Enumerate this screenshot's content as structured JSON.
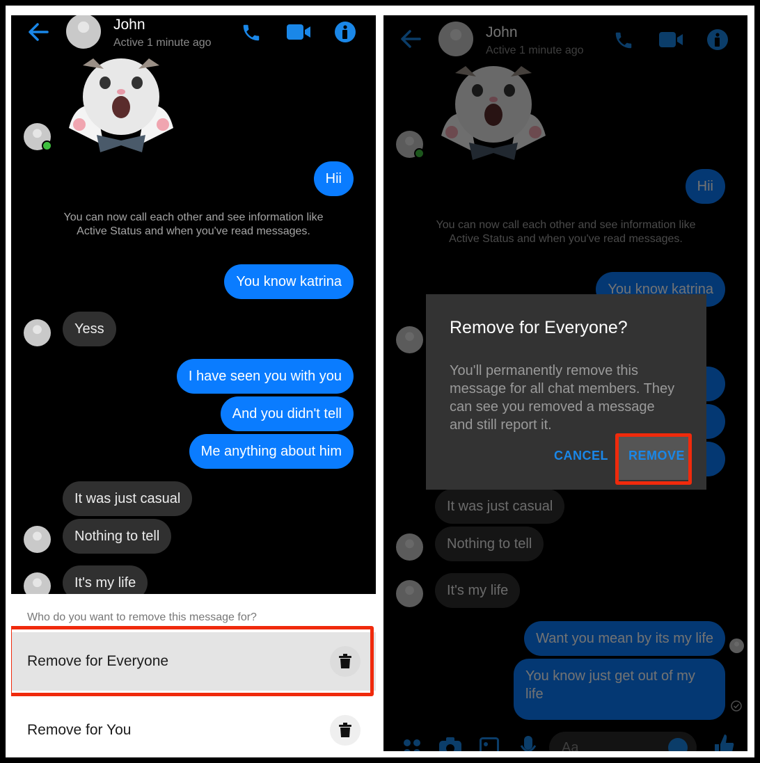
{
  "left_screen": {
    "header": {
      "contact_name": "John",
      "status": "Active 1 minute ago",
      "icons": [
        "back-arrow-icon",
        "phone-icon",
        "video-camera-icon",
        "info-icon"
      ]
    },
    "sticker": "cat-with-bowtie-sticker",
    "messages": [
      {
        "side": "out",
        "text": "Hii"
      },
      {
        "side": "system",
        "text": "You can now call each other and see information like Active Status and when you've read messages."
      },
      {
        "side": "out",
        "text": "You know katrina"
      },
      {
        "side": "in",
        "text": "Yess"
      },
      {
        "side": "out",
        "text": "I have seen you with you"
      },
      {
        "side": "out",
        "text": "And you didn't tell"
      },
      {
        "side": "out",
        "text": "Me anything about him"
      },
      {
        "side": "in",
        "text": "It was just casual"
      },
      {
        "side": "in",
        "text": "Nothing to tell"
      },
      {
        "side": "in",
        "text": "It's my life"
      }
    ],
    "remove_sheet": {
      "question": "Who do you want to remove this message for?",
      "options": [
        {
          "label": "Remove for Everyone",
          "icon": "trash-icon",
          "highlighted": true
        },
        {
          "label": "Remove for You",
          "icon": "trash-icon",
          "highlighted": false
        }
      ]
    }
  },
  "right_screen": {
    "header": {
      "contact_name": "John",
      "status": "Active 1 minute ago"
    },
    "messages": [
      {
        "side": "out",
        "text": "Hii"
      },
      {
        "side": "system",
        "text": "You can now call each other and see information like Active Status and when you've read messages."
      },
      {
        "side": "out",
        "text": "You know katrina"
      },
      {
        "side": "in",
        "text": "It was just casual"
      },
      {
        "side": "in",
        "text": "Nothing to tell"
      },
      {
        "side": "in",
        "text": "It's my life"
      },
      {
        "side": "out",
        "text": "Want you mean by its my life"
      },
      {
        "side": "out",
        "text": "You know just get out of my life"
      }
    ],
    "dialog": {
      "title": "Remove for Everyone?",
      "body": "You'll permanently remove this message for all chat members. They can see you removed a message and still report it.",
      "cancel_label": "CANCEL",
      "remove_label": "REMOVE",
      "highlighted_button": "remove"
    },
    "composer": {
      "placeholder": "Aa",
      "icons": [
        "apps-icon",
        "camera-icon",
        "gallery-icon",
        "microphone-icon",
        "emoji-icon",
        "thumbs-up-icon"
      ]
    }
  },
  "colors": {
    "accent_blue": "#0a7cff",
    "highlight_red": "#f02a0c",
    "incoming_bubble": "#303030"
  }
}
